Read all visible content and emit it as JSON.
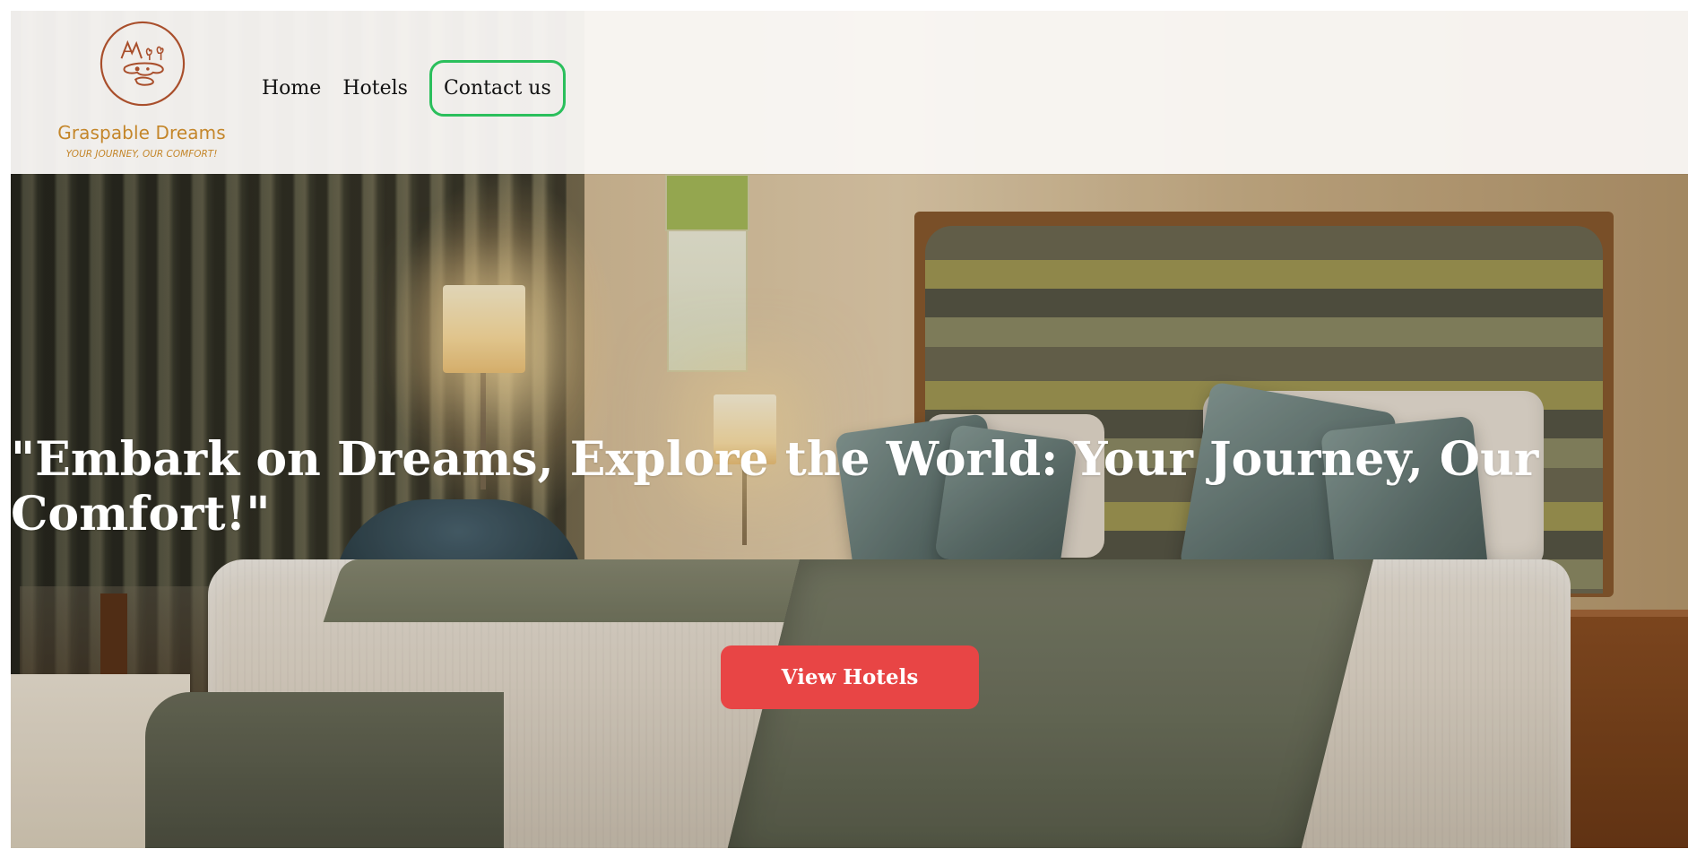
{
  "brand": {
    "name": "Graspable Dreams",
    "tagline": "YOUR JOURNEY, OUR COMFORT!",
    "logo_icon": "mountain-tree-logo-icon",
    "color": "#c4862a"
  },
  "nav": {
    "items": [
      {
        "label": "Home"
      },
      {
        "label": "Hotels"
      },
      {
        "label": "Contact us"
      }
    ],
    "contact_border_color": "#2bbf5c"
  },
  "hero": {
    "title": "\"Embark on Dreams, Explore the World: Your Journey, Our Comfort!\"",
    "cta_label": "View Hotels",
    "cta_color": "#e84545",
    "background_image": "hotel-bedroom-photo"
  }
}
